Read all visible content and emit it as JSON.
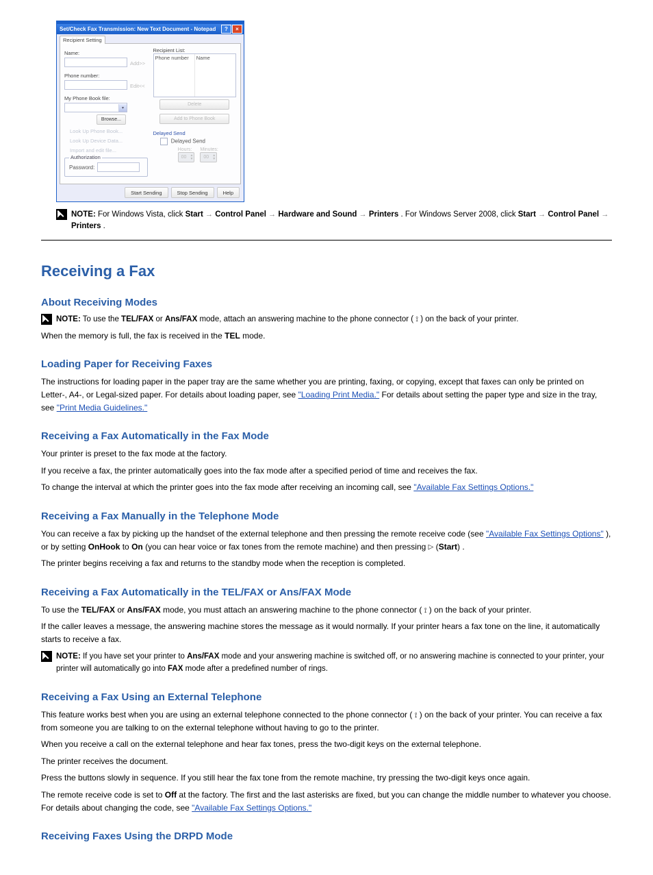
{
  "figure": {
    "window_title": "Set/Check Fax Transmission: New Text Document - Notepad",
    "tab_label": "Recipient Setting",
    "name_label": "Name:",
    "phone_label": "Phone number:",
    "add_btn": "Add>>",
    "edit_btn": "Edit<<",
    "phonebook_file_label": "My Phone Book file:",
    "browse_btn": "Browse...",
    "lookup_phone": "Look Up Phone Book...",
    "lookup_device": "Look Up Device Data...",
    "import_edit": "Import and edit file...",
    "auth_legend": "Authorization",
    "password_label": "Password:",
    "recipient_list_label": "Recipient List:",
    "col_phone": "Phone number",
    "col_name": "Name",
    "delete_btn": "Delete",
    "add_to_pb_btn": "Add to Phone Book",
    "delayed_send_label": "Delayed Send",
    "delayed_chk_label": "Delayed Send",
    "hours_label": "Hours:",
    "minutes_label": "Minutes:",
    "hours_val": "00",
    "minutes_val": "00",
    "start_btn": "Start Sending",
    "stop_btn": "Stop Sending",
    "help_btn": "Help"
  },
  "note1": {
    "label": "NOTE:",
    "text_before": "For Windows Vista, click ",
    "start": "Start",
    "ctrl_panel": "Control Panel",
    "hw_sound": "Hardware and Sound",
    "printers": "Printers",
    "text_mid": ". For Windows Server 2008, click ",
    "text_end": "."
  },
  "h2": "Receiving a Fax",
  "h3_modes": "About Receiving Modes",
  "note2": {
    "label": "NOTE:",
    "text1": "To use the ",
    "tel_fax": "TEL/FAX",
    "or": " or ",
    "ans_fax": "Ans/FAX",
    "text2": " mode, attach an answering machine to the phone connector (",
    "on_back": ") on the back of your printer."
  },
  "memfull": "When the memory is full, the fax is received in the ",
  "tel_mode": "TEL",
  "mode_word": " mode.",
  "h3_load": "Loading Paper for Receiving Faxes",
  "load_body1": "The instructions for loading paper in the paper tray are the same whether you are printing, faxing, or copying, except that faxes can only be printed on Letter-, A4-, or Legal-sized paper. For details about loading paper, see ",
  "link_loading": "\"Loading Print Media.\"",
  "load_body2": " For details about setting the paper type and size in the tray, see ",
  "link_guidelines": "\"Print Media Guidelines.\"",
  "h3_auto_fax": "Receiving a Fax Automatically in the Fax Mode",
  "auto_fax_body": "Your printer is preset to the fax mode at the factory.",
  "auto_fax_body2": "If you receive a fax, the printer automatically goes into the fax mode after a specified period of time and receives the fax.",
  "auto_fax_body3": "To change the interval at which the printer goes into the fax mode after receiving an incoming call, see ",
  "link_options": "\"Available Fax Settings Options.\"",
  "h3_manual_tel": "Receiving a Fax Manually in the Telephone Mode",
  "manual_tel_body": "You can receive a fax by picking up the handset of the external telephone and then pressing the remote receive code (see ",
  "link_options2": "\"Available Fax Settings Options\"",
  "manual_tel_body2": "), or by setting ",
  "onhook": "OnHook",
  "to_on": " to ",
  "on_txt": "On",
  "hear_fax": " (you can hear voice or fax tones from the remote machine) and then pressing ",
  "btn_start": "Start",
  "suffix": ".",
  "manual_tel_body3": "The printer begins receiving a fax and returns to the standby mode when the reception is completed.",
  "h3_auto_telfax": "Receiving a Fax Automatically in the TEL/FAX or Ans/FAX Mode",
  "auto_telfax_body": "To use the ",
  "auto_telfax_body2": " mode, you must attach an answering machine to the phone connector (",
  "on_back2": ") on the back of your printer.",
  "auto_telfax_body3": "If the caller leaves a message, the answering machine stores the message as it would normally. If your printer hears a fax tone on the line, it automatically starts to receive a fax.",
  "note3": {
    "label": "NOTE:",
    "text1": "If you have set your printer to ",
    "text2": " mode and your answering machine is switched off, or no answering machine is connected to your printer, your printer will automatically go into ",
    "fax_mode": "FAX",
    "text3": " mode after a predefined number of rings."
  },
  "h3_ext_phone": "Receiving a Fax Using an External Telephone",
  "ext_phone_body": "This feature works best when you are using an external telephone connected to the phone connector (",
  "ext_phone_body2": ") on the back of your printer. You can receive a fax from someone you are talking to on the external telephone without having to go to the printer.",
  "ext_phone_body3": "When you receive a call on the external telephone and hear fax tones, press the two-digit keys on the external telephone.",
  "ext_phone_body4": "The printer receives the document.",
  "ext_phone_body5": "Press the buttons slowly in sequence. If you still hear the fax tone from the remote machine, try pressing the two-digit keys once again.",
  "ext_phone_body6": "The remote receive code is set to ",
  "off_txt": "Off",
  "ext_phone_body7": " at the factory. The first and the last asterisks are fixed, but you can change the middle number to whatever you choose. For details about changing the code, see ",
  "link_options3": "\"Available Fax Settings Options.\"",
  "h3_drpd": "Receiving Faxes Using the DRPD Mode"
}
